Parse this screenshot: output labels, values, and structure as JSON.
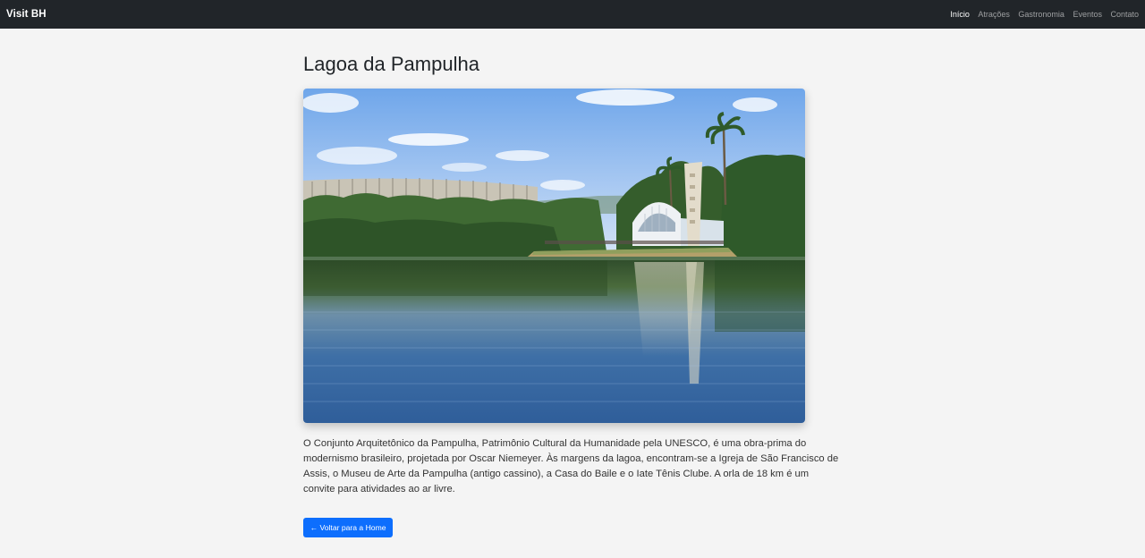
{
  "navbar": {
    "brand": "Visit BH",
    "links": [
      {
        "label": "Início",
        "active": true
      },
      {
        "label": "Atrações",
        "active": false
      },
      {
        "label": "Gastronomia",
        "active": false
      },
      {
        "label": "Eventos",
        "active": false
      },
      {
        "label": "Contato",
        "active": false
      }
    ]
  },
  "main": {
    "title": "Lagoa da Pampulha",
    "description": "O Conjunto Arquitetônico da Pampulha, Patrimônio Cultural da Humanidade pela UNESCO, é uma obra-prima do modernismo brasileiro, projetada por Oscar Niemeyer. Às margens da lagoa, encontram-se a Igreja de São Francisco de Assis, o Museu de Arte da Pampulha (antigo cassino), a Casa do Baile e o Iate Tênis Clube. A orla de 18 km é um convite para atividades ao ar livre.",
    "back_button": "← Voltar para a Home"
  },
  "colors": {
    "navbar_bg": "#212529",
    "page_bg": "#f4f4f4",
    "accent": "#0d6efd"
  }
}
